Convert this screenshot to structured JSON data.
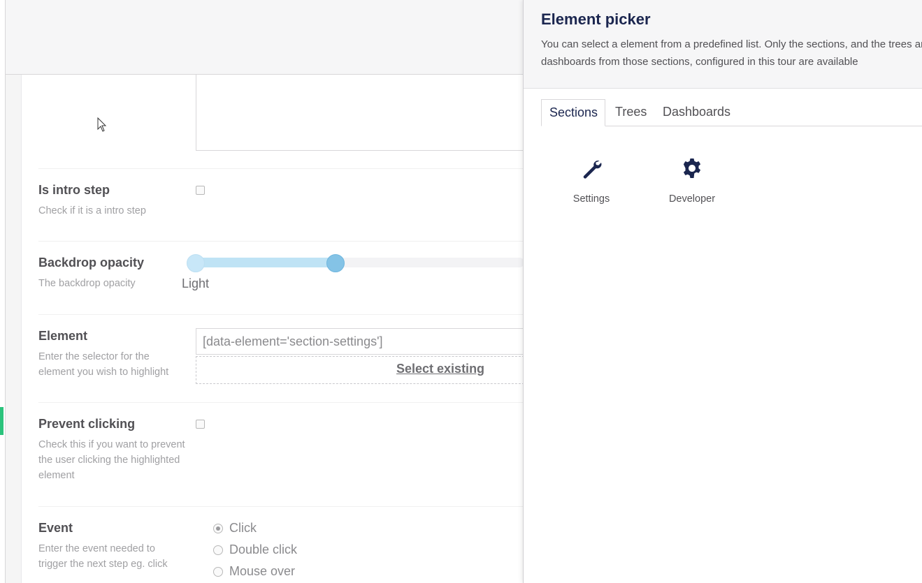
{
  "form": {
    "intro_step": {
      "label": "Is intro step",
      "description": "Check if it is a intro step",
      "checked": false
    },
    "backdrop_opacity": {
      "label": "Backdrop opacity",
      "description": "The backdrop opacity",
      "slider_min_label": "Light",
      "range_min": 0,
      "range_max": 0.43
    },
    "element": {
      "label": "Element",
      "description": "Enter the selector for the element you wish to highlight",
      "value": "[data-element='section-settings']",
      "select_existing_label": "Select existing"
    },
    "prevent_clicking": {
      "label": "Prevent clicking",
      "description": "Check this if you want to prevent the user clicking the highlighted element",
      "checked": false
    },
    "event": {
      "label": "Event",
      "description": "Enter the event needed to trigger the next step eg. click",
      "options": [
        "Click",
        "Double click",
        "Mouse over"
      ],
      "selected": "Click"
    }
  },
  "element_picker": {
    "title": "Element picker",
    "description": "You can select a element from a predefined list. Only the sections, and the trees and dashboards from those sections, configured in this tour are available",
    "tabs": [
      {
        "label": "Sections",
        "active": true
      },
      {
        "label": "Trees",
        "active": false
      },
      {
        "label": "Dashboards",
        "active": false
      }
    ],
    "sections": [
      {
        "label": "Settings",
        "icon": "wrench-icon"
      },
      {
        "label": "Developer",
        "icon": "gear-icon"
      }
    ]
  },
  "colors": {
    "accent": "#2bc37c",
    "title": "#1b264f",
    "slider_handle": "#84c3e6",
    "slider_fill": "#bfe3f5"
  }
}
